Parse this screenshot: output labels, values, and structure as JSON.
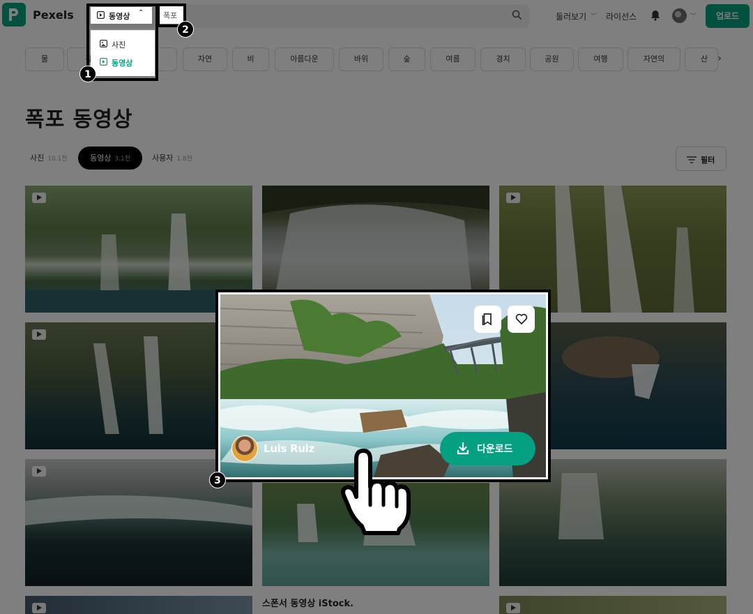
{
  "header": {
    "logo_text": "Pexels",
    "search_type_label": "동영상",
    "query": "폭포",
    "nav_explore": "둘러보기",
    "nav_license": "라이선스",
    "upload_label": "업로드",
    "brand_color": "#05a081"
  },
  "dropdown": {
    "items": [
      {
        "label": "사진",
        "icon": "image-icon",
        "selected": false
      },
      {
        "label": "동영상",
        "icon": "play-icon",
        "selected": true
      }
    ]
  },
  "tags": [
    "물",
    "강",
    "",
    "자연",
    "비",
    "아름다운",
    "바위",
    "숲",
    "여름",
    "경치",
    "공원",
    "여행",
    "자연의",
    "산"
  ],
  "page_title": "폭포 동영상",
  "filter_tabs": [
    {
      "label": "사진",
      "count": "10.1천"
    },
    {
      "label": "동영상",
      "count": "3.1천",
      "active": true
    },
    {
      "label": "사용자",
      "count": "1.8천"
    }
  ],
  "filter_label": "필터",
  "featured": {
    "author": "Luis Ruiz",
    "download_label": "다운로드"
  },
  "sponsor_title": "스폰서 동영상 iStock.",
  "steps": [
    "1",
    "2",
    "3"
  ]
}
